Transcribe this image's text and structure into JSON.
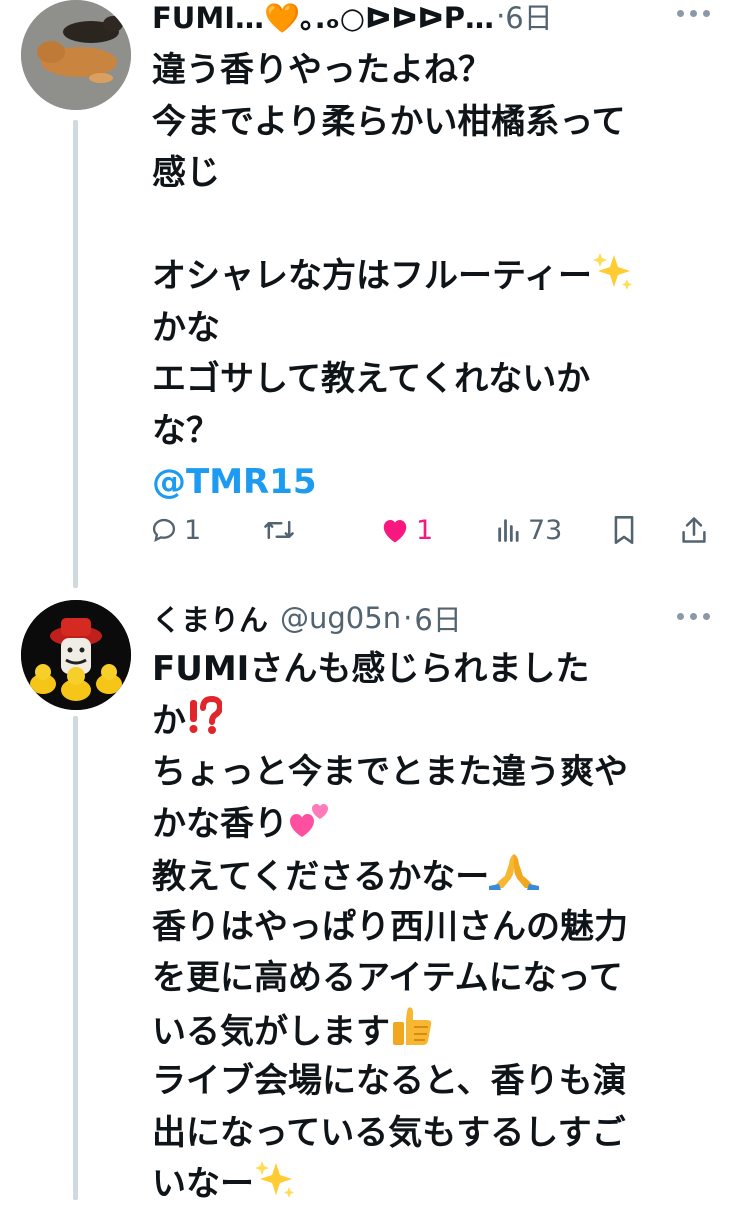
{
  "tweets": [
    {
      "name": "FUMI…🧡｡.ₒ○ᐅᐅᐅP…",
      "handle": "",
      "sep": "·",
      "time": "6日",
      "lines": [
        "違う香りやったよね？",
        "今までより柔らかい柑橘系って",
        "感じ",
        "",
        "オシャレな方はフルーティー",
        "かな",
        "エゴサして教えてくれないか",
        "な？"
      ],
      "mention": "@TMR15",
      "actions": {
        "replies": "1",
        "likes": "1",
        "views": "73"
      }
    },
    {
      "name": "くまりん",
      "handle": "@ug05n",
      "sep": "·",
      "time": "6日",
      "lines": [
        "FUMIさんも感じられました",
        "か",
        "ちょっと今までとまた違う爽や",
        "かな香り",
        "教えてくださるかなー",
        "香りはやっぱり西川さんの魅力",
        "を更に高めるアイテムになって",
        "いる気がします",
        "ライブ会場になると、香りも演",
        "出になっている気もするしすご",
        "いなー"
      ]
    }
  ],
  "icons": [
    "reply-icon",
    "retweet-icon",
    "heart-icon",
    "views-icon",
    "bookmark-icon",
    "share-icon",
    "more-icon",
    "sparkles-icon",
    "exclamation-question-icon",
    "two-hearts-icon",
    "praying-hands-icon",
    "thumbs-up-icon"
  ],
  "colors": {
    "accent": "#1d9bf0",
    "like": "#f91880",
    "muted": "#536471",
    "thread": "#cfd9de"
  }
}
